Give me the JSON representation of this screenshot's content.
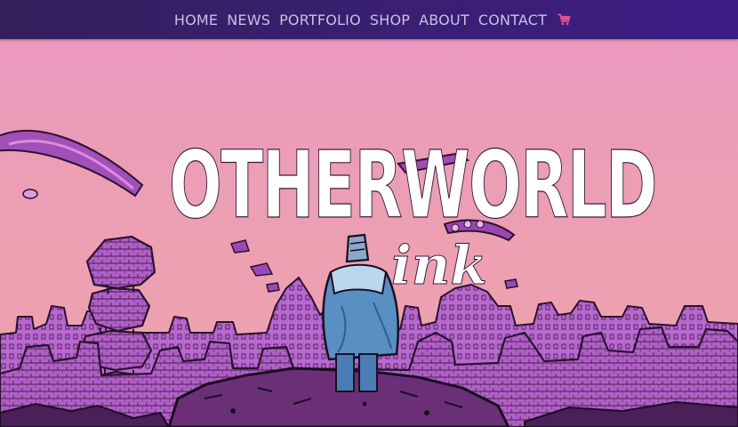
{
  "nav": {
    "items": [
      {
        "label": "HOME"
      },
      {
        "label": "NEWS"
      },
      {
        "label": "PORTFOLIO"
      },
      {
        "label": "SHOP"
      },
      {
        "label": "ABOUT"
      },
      {
        "label": "CONTACT"
      }
    ],
    "cart_icon": "shopping-cart-icon"
  },
  "hero": {
    "title": "OTHERWORLD",
    "subtitle": "ink"
  },
  "colors": {
    "nav_bg": "#3a1f73",
    "nav_text": "#cdbfe6",
    "cart_accent": "#e0508f",
    "sky": "#ec9fb3",
    "city": "#b467c8",
    "ink": "#1a0f22"
  }
}
